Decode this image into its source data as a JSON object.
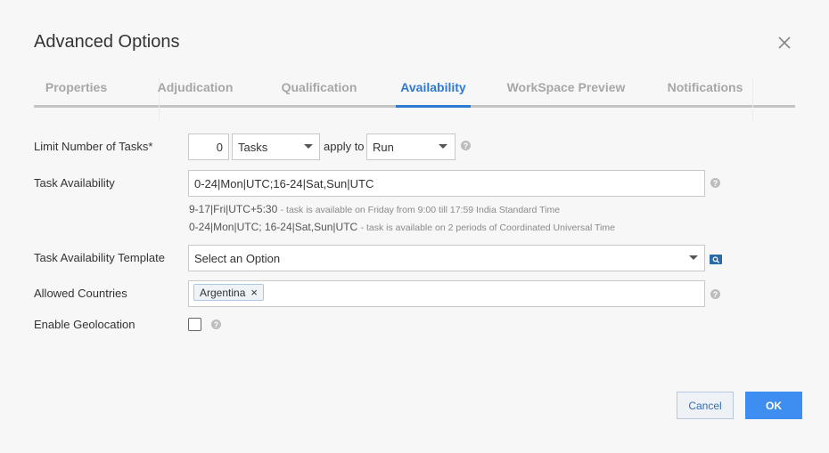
{
  "dialog": {
    "title": "Advanced Options"
  },
  "tabs": [
    {
      "label": "Properties"
    },
    {
      "label": "Adjudication"
    },
    {
      "label": "Qualification"
    },
    {
      "label": "Availability"
    },
    {
      "label": "WorkSpace Preview"
    },
    {
      "label": "Notifications"
    }
  ],
  "form": {
    "limit": {
      "label": "Limit Number of Tasks*",
      "count": "0",
      "unit": "Tasks",
      "apply_to_label": "apply to",
      "apply_to_value": "Run"
    },
    "availability": {
      "label": "Task Availability",
      "value": "0-24|Mon|UTC;16-24|Sat,Sun|UTC",
      "hint1_code": "9-17|Fri|UTC+5:30",
      "hint1_desc": "- task is available on Friday from 9:00 till 17:59 India Standard Time",
      "hint2_code": "0-24|Mon|UTC; 16-24|Sat,Sun|UTC",
      "hint2_desc": "- task is available on 2 periods of Coordinated Universal Time"
    },
    "template": {
      "label": "Task Availability Template",
      "placeholder": "Select an Option"
    },
    "countries": {
      "label": "Allowed Countries",
      "tags": [
        "Argentina"
      ],
      "remove_symbol": "×"
    },
    "geolocation": {
      "label": "Enable Geolocation",
      "checked": false
    }
  },
  "help_symbol": "?",
  "buttons": {
    "cancel": "Cancel",
    "ok": "OK"
  },
  "colors": {
    "accent": "#2f7ad1",
    "ok_bg": "#3d8ef0",
    "search_icon_bg": "#2a6aa8"
  }
}
